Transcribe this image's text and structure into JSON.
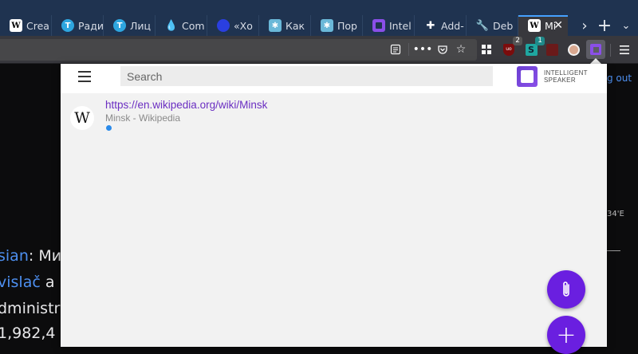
{
  "tabs": [
    {
      "label": "Crea",
      "favicon": "wikipedia",
      "color": "#ffffff"
    },
    {
      "label": "Ради",
      "favicon": "telegram",
      "color": "#2ea6df"
    },
    {
      "label": "Лиц",
      "favicon": "telegram",
      "color": "#2ea6df"
    },
    {
      "label": "Com",
      "favicon": "flame",
      "color": "#1f6fd6"
    },
    {
      "label": "«Хо",
      "favicon": "blue-circle",
      "color": "#2a3fe0"
    },
    {
      "label": "Как",
      "favicon": "sprite",
      "color": "#6ab8d8"
    },
    {
      "label": "Пор",
      "favicon": "sprite",
      "color": "#6ab8d8"
    },
    {
      "label": "Intel",
      "favicon": "intelligent-speaker",
      "color": "#8a4fe8"
    },
    {
      "label": "Add-",
      "favicon": "puzzle",
      "color": "#ffffff"
    },
    {
      "label": "Deb",
      "favicon": "wrench",
      "color": "#ffffff"
    },
    {
      "label": "Mi",
      "favicon": "wikipedia",
      "color": "#ffffff"
    }
  ],
  "toolbar": {
    "ublock_badge": "2",
    "stylus_badge": "1"
  },
  "background_page": {
    "line1_link": "sian",
    "line1_text": ": Ми",
    "line2_link": "vislač",
    "line2_text": " a",
    "line3_text": "dministr",
    "line4_text": " 1,982,4",
    "right_link": "g out",
    "right_coord": "34'E"
  },
  "panel": {
    "search_placeholder": "Search",
    "brand_line1": "INTELLIGENT",
    "brand_line2": "SPEAKER",
    "item": {
      "url": "https://en.wikipedia.org/wiki/Minsk",
      "title": "Minsk - Wikipedia"
    }
  },
  "colors": {
    "accent": "#6a1fe0",
    "link": "#6b2fc2",
    "dot": "#2a8aea"
  }
}
